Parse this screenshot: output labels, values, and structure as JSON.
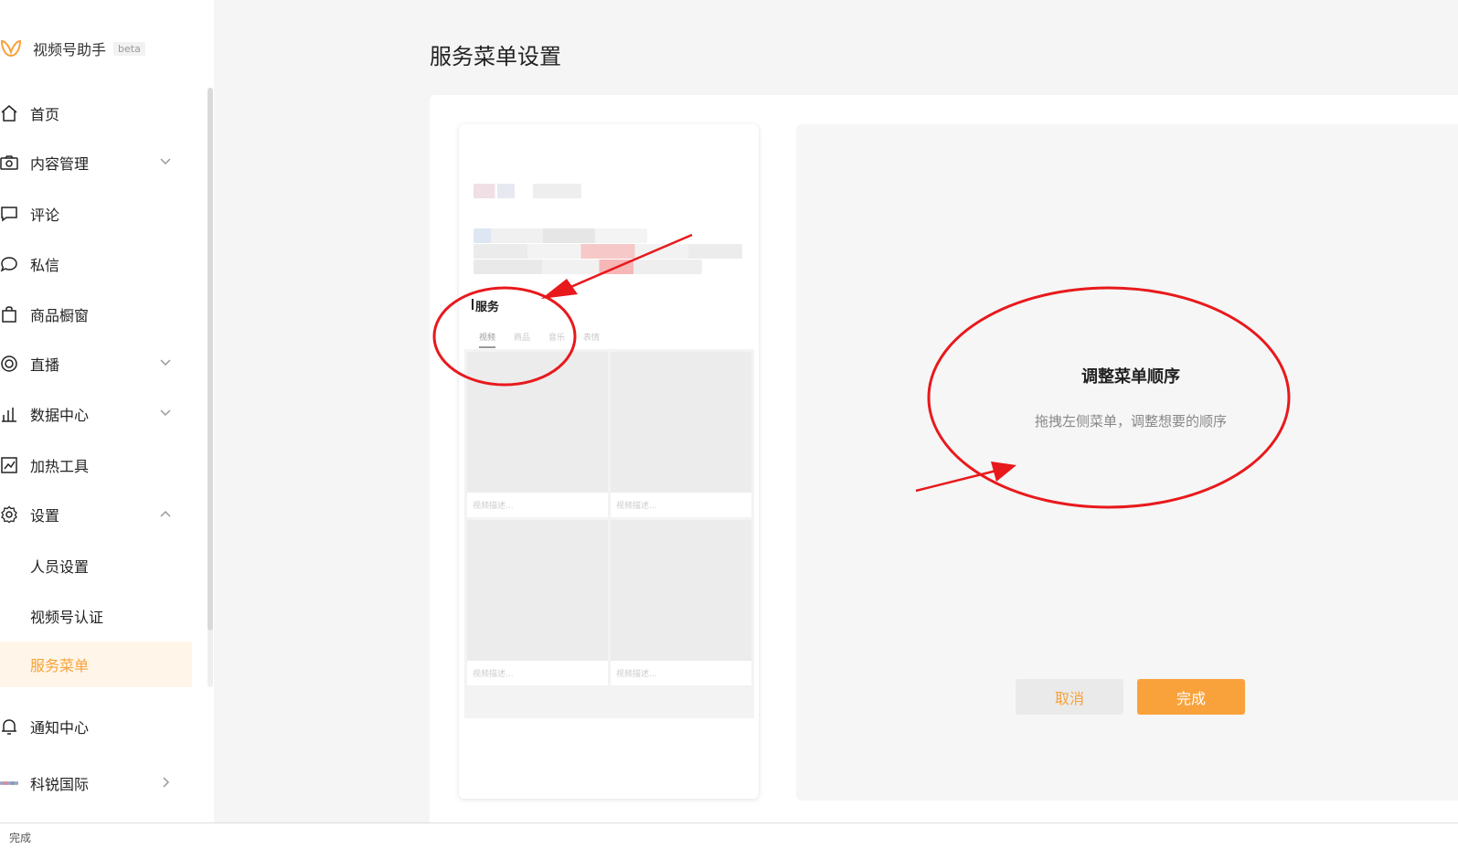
{
  "app": {
    "name": "视频号助手",
    "badge": "beta"
  },
  "sidebar": {
    "items": [
      {
        "label": "首页"
      },
      {
        "label": "内容管理"
      },
      {
        "label": "评论"
      },
      {
        "label": "私信"
      },
      {
        "label": "商品橱窗"
      },
      {
        "label": "直播"
      },
      {
        "label": "数据中心"
      },
      {
        "label": "加热工具"
      },
      {
        "label": "设置"
      },
      {
        "label": "人员设置"
      },
      {
        "label": "视频号认证"
      },
      {
        "label": "服务菜单"
      },
      {
        "label": "通知中心"
      },
      {
        "label": "科锐国际"
      }
    ]
  },
  "main": {
    "title": "服务菜单设置"
  },
  "preview": {
    "section_label": "服务",
    "tabs": [
      "视频",
      "商品",
      "音乐",
      "表情"
    ],
    "card_desc": "视频描述..."
  },
  "hint": {
    "title": "调整菜单顺序",
    "subtitle": "拖拽左侧菜单，调整想要的顺序"
  },
  "buttons": {
    "cancel": "取消",
    "done": "完成"
  },
  "status": {
    "text": "完成"
  },
  "colors": {
    "accent": "#f7a23a",
    "annotation": "#e8191c"
  }
}
